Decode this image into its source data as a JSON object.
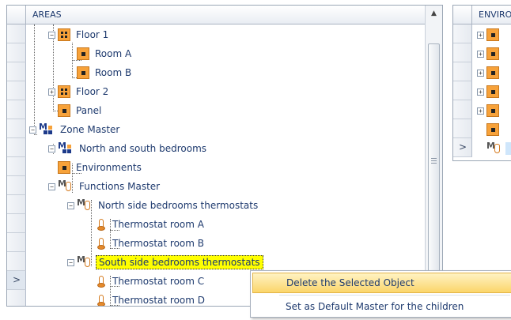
{
  "areas_panel": {
    "header": "AREAS",
    "tree": [
      {
        "label": "Floor 1",
        "icon": "floor-icon",
        "expander": "⊟",
        "depth": 2
      },
      {
        "label": "Room A",
        "icon": "room-icon",
        "depth": 3
      },
      {
        "label": "Room B",
        "icon": "room-icon",
        "depth": 3
      },
      {
        "label": "Floor 2",
        "icon": "floor-icon",
        "expander": "⊞",
        "depth": 2
      },
      {
        "label": "Panel",
        "icon": "room-icon",
        "depth": 2
      },
      {
        "label": "Zone Master",
        "icon": "zone-master-icon",
        "expander": "⊟",
        "depth": 0
      },
      {
        "label": "North and south bedrooms",
        "icon": "zone-master-icon",
        "expander": "⊟",
        "depth": 1
      },
      {
        "label": "Environments",
        "icon": "room-icon",
        "depth": 2
      },
      {
        "label": "Functions Master",
        "icon": "functions-master-icon",
        "expander": "⊟",
        "depth": 2
      },
      {
        "label": "North side bedrooms thermostats",
        "icon": "functions-master-icon",
        "expander": "⊟",
        "depth": 3
      },
      {
        "label": "Thermostat room A",
        "icon": "thermostat-icon",
        "depth": 4
      },
      {
        "label": "Thermostat room B",
        "icon": "thermostat-icon",
        "depth": 4
      },
      {
        "label": "South side bedrooms thermostats",
        "icon": "functions-master-icon",
        "expander": "⊟",
        "depth": 3,
        "selected": true
      },
      {
        "label": "Thermostat room C",
        "icon": "thermostat-icon",
        "depth": 4
      },
      {
        "label": "Thermostat room D",
        "icon": "thermostat-icon",
        "depth": 4
      }
    ],
    "selected_row_marker": ">"
  },
  "env_panel": {
    "header": "ENVIRO",
    "selected_row_marker": ">"
  },
  "context_menu": {
    "items": [
      {
        "label": "Delete the Selected Object",
        "highlighted": true
      },
      {
        "label": "Set as Default Master for the children",
        "highlighted": false
      }
    ]
  },
  "colors": {
    "selection": "#ffff00",
    "menu_highlight": "#fbd56a",
    "icon_orange": "#f7a23a",
    "text": "#1e3a6e"
  }
}
